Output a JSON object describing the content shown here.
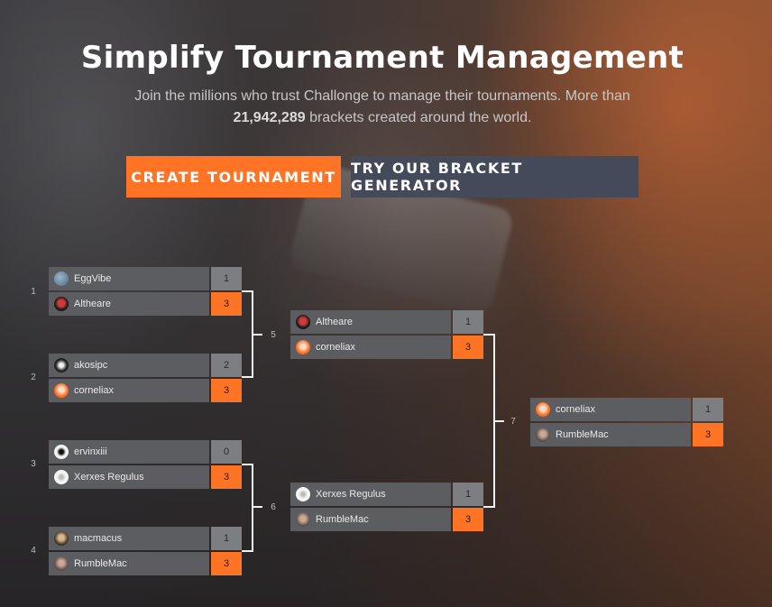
{
  "hero": {
    "title": "Simplify Tournament Management",
    "subtitle_lead": "Join the millions who trust Challonge to manage their tournaments. More than",
    "bracket_count": "21,942,289",
    "subtitle_tail": "brackets created around the world."
  },
  "buttons": {
    "create": "CREATE TOURNAMENT",
    "generator": "TRY OUR BRACKET GENERATOR"
  },
  "colors": {
    "accent": "#ff7324",
    "secondary_button": "#444a5a",
    "player_bg": "#5c5d60",
    "score_bg": "#7d7e82"
  },
  "bracket": {
    "matches": [
      {
        "label": "1",
        "players": [
          {
            "name": "EggVibe",
            "score": "1",
            "avatar": "eggvibe-avatar"
          },
          {
            "name": "Altheare",
            "score": "3",
            "avatar": "altheare-avatar"
          }
        ]
      },
      {
        "label": "2",
        "players": [
          {
            "name": "akosipc",
            "score": "2",
            "avatar": "akosipc-avatar"
          },
          {
            "name": "corneliax",
            "score": "3",
            "avatar": "corneliax-avatar"
          }
        ]
      },
      {
        "label": "3",
        "players": [
          {
            "name": "ervinxiii",
            "score": "0",
            "avatar": "ervinxiii-avatar"
          },
          {
            "name": "Xerxes Regulus",
            "score": "3",
            "avatar": "xerxes-avatar"
          }
        ]
      },
      {
        "label": "4",
        "players": [
          {
            "name": "macmacus",
            "score": "1",
            "avatar": "macmacus-avatar"
          },
          {
            "name": "RumbleMac",
            "score": "3",
            "avatar": "rumblemac-avatar"
          }
        ]
      },
      {
        "label": "5",
        "players": [
          {
            "name": "Altheare",
            "score": "1",
            "avatar": "altheare-avatar"
          },
          {
            "name": "corneliax",
            "score": "3",
            "avatar": "corneliax-avatar"
          }
        ]
      },
      {
        "label": "6",
        "players": [
          {
            "name": "Xerxes Regulus",
            "score": "1",
            "avatar": "xerxes-avatar"
          },
          {
            "name": "RumbleMac",
            "score": "3",
            "avatar": "rumblemac-avatar"
          }
        ]
      },
      {
        "label": "7",
        "players": [
          {
            "name": "corneliax",
            "score": "1",
            "avatar": "corneliax-avatar"
          },
          {
            "name": "RumbleMac",
            "score": "3",
            "avatar": "rumblemac-avatar"
          }
        ]
      }
    ]
  }
}
